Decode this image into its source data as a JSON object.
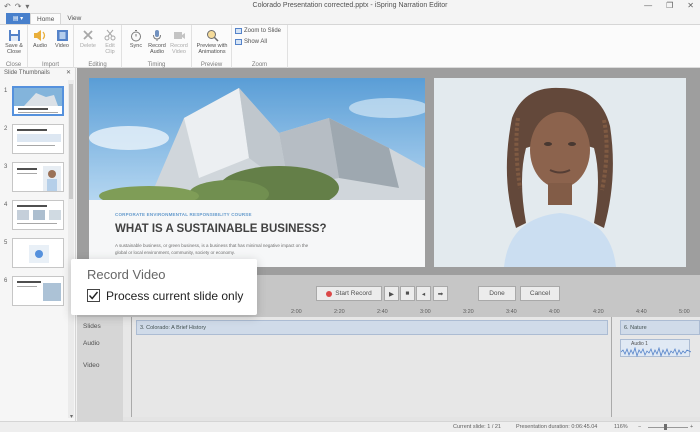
{
  "window": {
    "title": "Colorado Presentation corrected.pptx - iSpring Narration Editor"
  },
  "tabs": [
    {
      "label": "Home"
    },
    {
      "label": "View"
    }
  ],
  "ribbon": {
    "groups": {
      "close": {
        "label": "Close",
        "save_close": "Save &\nClose"
      },
      "import": {
        "label": "Import",
        "audio": "Audio",
        "video": "Video"
      },
      "editing": {
        "label": "Editing",
        "delete": "Delete",
        "edit_clip": "Edit\nClip"
      },
      "timing": {
        "label": "Timing",
        "sync": "Sync",
        "record_audio": "Record\nAudio",
        "record_video": "Record\nVideo"
      },
      "preview": {
        "label": "Preview",
        "preview_animations": "Preview with\nAnimations"
      },
      "zoom": {
        "label": "Zoom",
        "zoom_to_slide": "Zoom to Slide",
        "show_all": "Show All"
      }
    }
  },
  "left_panel": {
    "title": "Slide Thumbnails",
    "thumbnails": [
      {
        "number": "1"
      },
      {
        "number": "2"
      },
      {
        "number": "3"
      },
      {
        "number": "4"
      },
      {
        "number": "5"
      },
      {
        "number": "6"
      }
    ]
  },
  "slide": {
    "kicker": "CORPORATE ENVIRONMENTAL RESPONSIBILITY COURSE",
    "heading": "WHAT IS A SUSTAINABLE BUSINESS?",
    "body": "A sustainable business, or green business, is a business that has minimal negative impact on the global or local environment, community, society or economy."
  },
  "controls": {
    "start_record": "Start Record",
    "done": "Done",
    "cancel": "Cancel"
  },
  "timeline": {
    "labels": {
      "slides": "Slides",
      "audio": "Audio",
      "video": "Video"
    },
    "ticks": [
      "2:00",
      "2:20",
      "2:40",
      "3:00",
      "3:20",
      "3:40",
      "4:00",
      "4:20",
      "4:40",
      "5:00",
      "5:20",
      "5:40",
      "6:00",
      "6:20"
    ],
    "slide_clips": [
      {
        "label": "3. Colorado: A Brief History"
      },
      {
        "label": "6. Nature"
      }
    ],
    "audio_clip_label": "Audio 1"
  },
  "status": {
    "current_slide": "Current slide: 1 / 21",
    "duration": "Presentation duration: 0:06:45.04",
    "zoom": "116%"
  },
  "popup": {
    "title": "Record Video",
    "checkbox_label": "Process current slide only",
    "checked": true
  },
  "colors": {
    "accent": "#2b6cc4",
    "record": "#d62b2b"
  }
}
